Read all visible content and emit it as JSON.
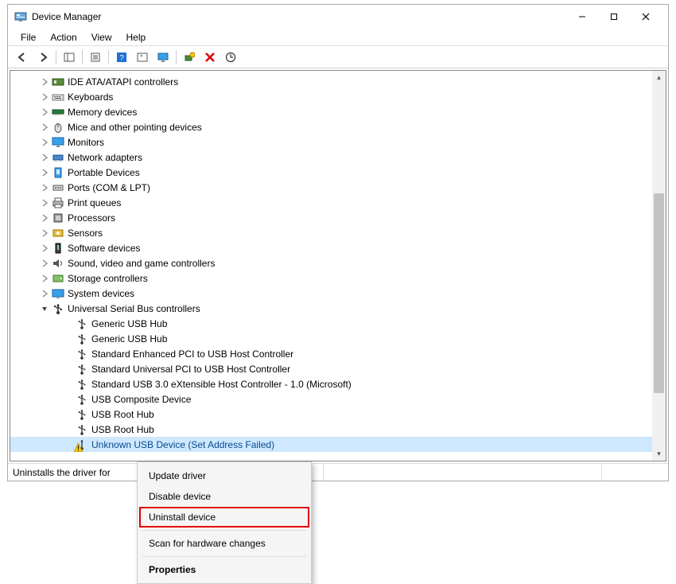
{
  "window": {
    "title": "Device Manager"
  },
  "menubar": [
    "File",
    "Action",
    "View",
    "Help"
  ],
  "toolbar_icons": [
    "back-icon",
    "forward-icon",
    "sep",
    "show-hide-tree-icon",
    "sep",
    "properties-icon",
    "sep",
    "help-icon",
    "refresh-icon",
    "display-icon",
    "sep",
    "add-legacy-icon",
    "delete-icon",
    "scan-hardware-icon"
  ],
  "tree": {
    "categories": [
      {
        "label": "IDE ATA/ATAPI controllers",
        "icon": "storage-controller-icon",
        "expanded": false
      },
      {
        "label": "Keyboards",
        "icon": "keyboard-icon",
        "expanded": false
      },
      {
        "label": "Memory devices",
        "icon": "memory-icon",
        "expanded": false
      },
      {
        "label": "Mice and other pointing devices",
        "icon": "mouse-icon",
        "expanded": false
      },
      {
        "label": "Monitors",
        "icon": "monitor-icon",
        "expanded": false
      },
      {
        "label": "Network adapters",
        "icon": "network-icon",
        "expanded": false
      },
      {
        "label": "Portable Devices",
        "icon": "portable-icon",
        "expanded": false
      },
      {
        "label": "Ports (COM & LPT)",
        "icon": "port-icon",
        "expanded": false
      },
      {
        "label": "Print queues",
        "icon": "printer-icon",
        "expanded": false
      },
      {
        "label": "Processors",
        "icon": "cpu-icon",
        "expanded": false
      },
      {
        "label": "Sensors",
        "icon": "sensor-icon",
        "expanded": false
      },
      {
        "label": "Software devices",
        "icon": "software-icon",
        "expanded": false
      },
      {
        "label": "Sound, video and game controllers",
        "icon": "sound-icon",
        "expanded": false
      },
      {
        "label": "Storage controllers",
        "icon": "storage-icon",
        "expanded": false
      },
      {
        "label": "System devices",
        "icon": "system-icon",
        "expanded": false
      },
      {
        "label": "Universal Serial Bus controllers",
        "icon": "usb-icon",
        "expanded": true,
        "children": [
          {
            "label": "Generic USB Hub",
            "icon": "usb-plug-icon"
          },
          {
            "label": "Generic USB Hub",
            "icon": "usb-plug-icon"
          },
          {
            "label": "Standard Enhanced PCI to USB Host Controller",
            "icon": "usb-plug-icon"
          },
          {
            "label": "Standard Universal PCI to USB Host Controller",
            "icon": "usb-plug-icon"
          },
          {
            "label": "Standard USB 3.0 eXtensible Host Controller - 1.0 (Microsoft)",
            "icon": "usb-plug-icon"
          },
          {
            "label": "USB Composite Device",
            "icon": "usb-plug-icon"
          },
          {
            "label": "USB Root Hub",
            "icon": "usb-plug-icon"
          },
          {
            "label": "USB Root Hub",
            "icon": "usb-plug-icon"
          },
          {
            "label": "Unknown USB Device (Set Address Failed)",
            "icon": "usb-warning-icon",
            "selected": true
          }
        ]
      }
    ]
  },
  "context_menu": {
    "items": [
      {
        "label": "Update driver",
        "type": "item"
      },
      {
        "label": "Disable device",
        "type": "item"
      },
      {
        "label": "Uninstall device",
        "type": "item",
        "highlight": true
      },
      {
        "type": "sep"
      },
      {
        "label": "Scan for hardware changes",
        "type": "item"
      },
      {
        "type": "sep"
      },
      {
        "label": "Properties",
        "type": "item",
        "bold": true
      }
    ]
  },
  "statusbar": {
    "text": "Uninstalls the driver for"
  }
}
